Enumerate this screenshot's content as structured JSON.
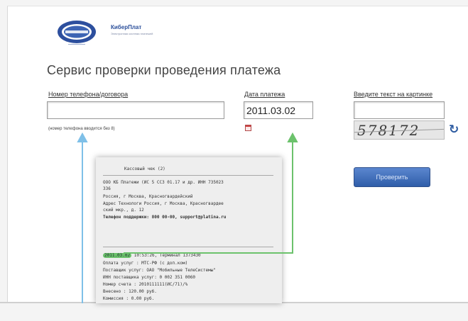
{
  "header": {
    "brand_name": "КиберПлат",
    "brand_sub": "Электронная система платежей"
  },
  "page_title": "Сервис проверки проведения платежа",
  "form": {
    "phone_label": "Номер телефона/договора",
    "phone_value": "",
    "phone_hint": "(номер телефона вводится без 8)",
    "date_label": "Дата платежа",
    "date_value": "2011.03.02",
    "captcha_label": "Введите текст на картинке",
    "captcha_value": "",
    "captcha_text": "578172",
    "check_button": "Проверить"
  },
  "receipt": {
    "header": "Кассовый чек (2)",
    "lines": [
      "ООО КБ Платежи (ИС 5 ССЗ 01.17 и др. ИНН 735023",
      "ЗЗ6",
      "Россия, г Москва, Красногвардейский",
      "Адрес Технологи Россия, г Москва, Красногвардее",
      "ский мкр., д. 12",
      "Телефон поддержки: 800 00-00, support@platina.ru"
    ],
    "payment_highlight": "2011.03.02",
    "payment_tail": "10:53:26, Терминал 1373430",
    "payment_lines": [
      "Оплата услуг   : МТС-РФ (с доп.ком)",
      "Поставщик услуг: ОАО \"Мобильные ТелеСистемы\"",
      "ИНН поставщика услуг: 0 002 351 0060",
      "Номер счета    : 2010111111(ИС/71)/%",
      "Внесено        : 120.00 руб.",
      "Комиссия       : 0.00 руб."
    ]
  },
  "colors": {
    "arrow_blue": "#7fc0e8",
    "arrow_green": "#6cc26c",
    "button": "#3f6fbf",
    "title": "#444444"
  }
}
